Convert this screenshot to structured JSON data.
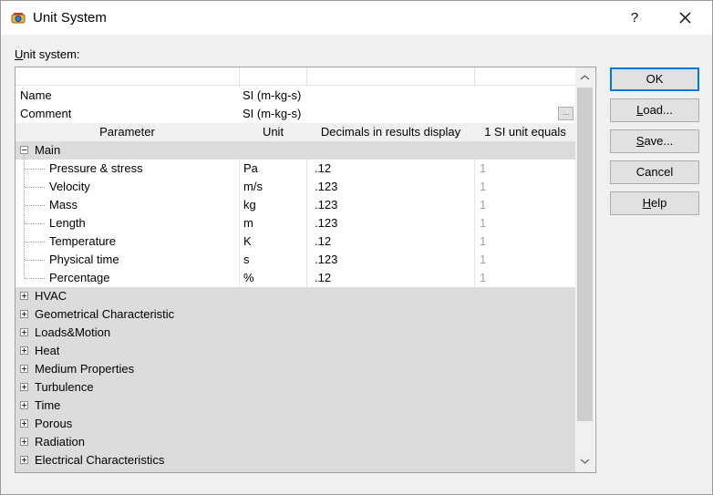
{
  "window": {
    "title": "Unit System",
    "help_label": "?"
  },
  "form": {
    "unit_system_label": "Unit system:"
  },
  "grid": {
    "name_label": "Name",
    "name_value": "SI (m-kg-s)",
    "comment_label": "Comment",
    "comment_value": "SI (m-kg-s)",
    "ellipsis_label": "...",
    "headers": [
      "Parameter",
      "Unit",
      "Decimals in results display",
      "1 SI unit equals"
    ],
    "main_group": "Main",
    "main_rows": [
      {
        "param": "Pressure & stress",
        "unit": "Pa",
        "decimals": ".12",
        "equals": "1"
      },
      {
        "param": "Velocity",
        "unit": "m/s",
        "decimals": ".123",
        "equals": "1"
      },
      {
        "param": "Mass",
        "unit": "kg",
        "decimals": ".123",
        "equals": "1"
      },
      {
        "param": "Length",
        "unit": "m",
        "decimals": ".123",
        "equals": "1"
      },
      {
        "param": "Temperature",
        "unit": "K",
        "decimals": ".12",
        "equals": "1"
      },
      {
        "param": "Physical time",
        "unit": "s",
        "decimals": ".123",
        "equals": "1"
      },
      {
        "param": "Percentage",
        "unit": "%",
        "decimals": ".12",
        "equals": "1"
      }
    ],
    "groups": [
      "HVAC",
      "Geometrical Characteristic",
      "Loads&Motion",
      "Heat",
      "Medium Properties",
      "Turbulence",
      "Time",
      "Porous",
      "Radiation",
      "Electrical Characteristics"
    ]
  },
  "buttons": {
    "ok": "OK",
    "load": "Load...",
    "save": "Save...",
    "cancel": "Cancel",
    "help": "Help"
  }
}
